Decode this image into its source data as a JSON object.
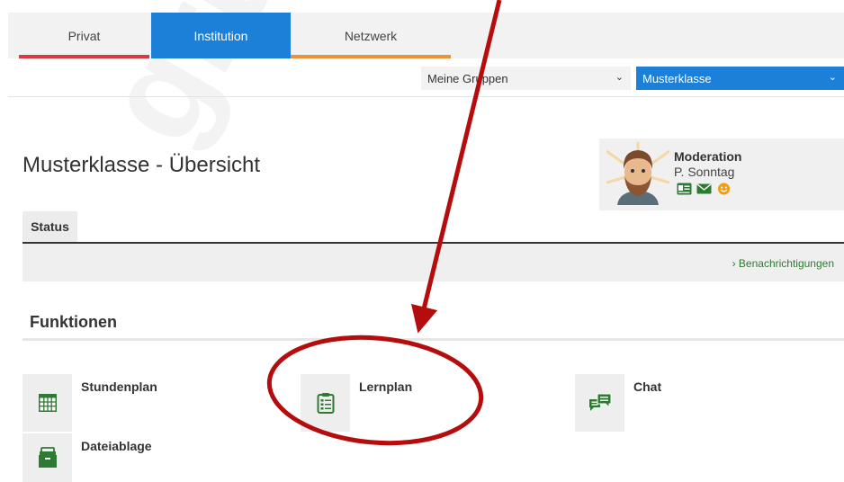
{
  "watermark": "grünle",
  "tabs": [
    {
      "label": "Privat",
      "accent": "#e0363f"
    },
    {
      "label": "Institution",
      "accent": "#1c7fd8"
    },
    {
      "label": "Netzwerk",
      "accent": "#f0913a"
    }
  ],
  "selects": {
    "groups": "Meine Gruppen",
    "class": "Musterklasse"
  },
  "page_title": "Musterklasse - Übersicht",
  "moderation": {
    "role": "Moderation",
    "name": "P. Sonntag",
    "icons": [
      "contact-card-icon",
      "envelope-icon",
      "smiley-icon"
    ]
  },
  "status": {
    "tab_label": "Status",
    "notifications_label": "Benachrichtigungen",
    "chevron": "›"
  },
  "functions": {
    "title": "Funktionen",
    "items": [
      {
        "label": "Stundenplan",
        "icon": "calendar-grid-icon"
      },
      {
        "label": "Lernplan",
        "icon": "clipboard-list-icon"
      },
      {
        "label": "Chat",
        "icon": "chat-bubbles-icon"
      },
      {
        "label": "Dateiablage",
        "icon": "file-cabinet-icon"
      }
    ]
  },
  "colors": {
    "brand_blue": "#1c7fd8",
    "icon_green": "#2e7a33",
    "annotation_red": "#b50d0d"
  }
}
